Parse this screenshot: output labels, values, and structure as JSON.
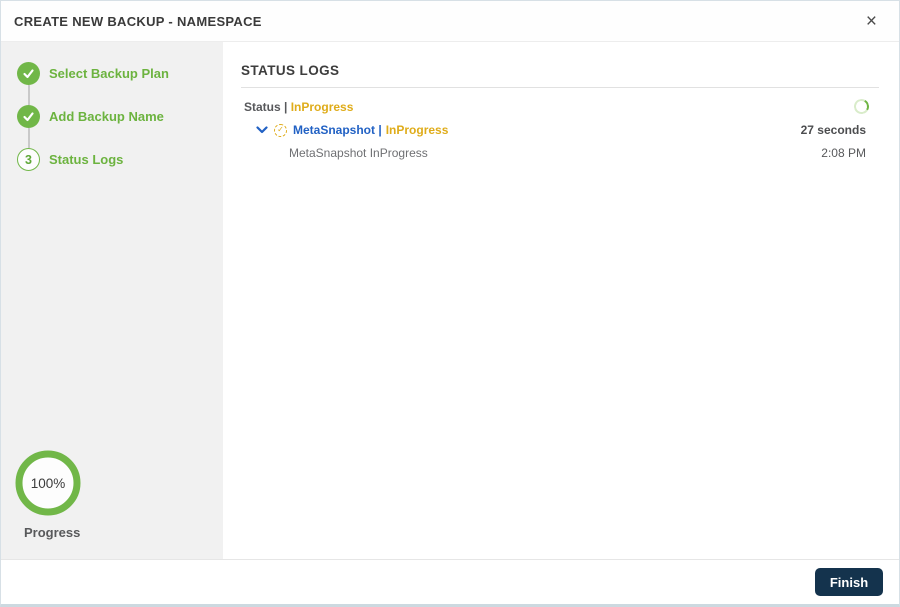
{
  "modal": {
    "title": "CREATE NEW BACKUP - NAMESPACE",
    "close_icon": "×"
  },
  "sidebar": {
    "steps": [
      {
        "label": "Select Backup Plan",
        "state": "complete"
      },
      {
        "label": "Add Backup Name",
        "state": "complete"
      },
      {
        "label": "Status Logs",
        "state": "current",
        "number": "3"
      }
    ],
    "progress": {
      "percent": "100%",
      "label": "Progress"
    }
  },
  "main": {
    "heading": "STATUS LOGS",
    "status_line": {
      "prefix": "Status |",
      "value": "InProgress"
    },
    "log_entry": {
      "name": "MetaSnapshot |",
      "status": "InProgress",
      "duration": "27 seconds",
      "detail": "MetaSnapshot InProgress",
      "time": "2:08 PM"
    }
  },
  "footer": {
    "finish_label": "Finish"
  },
  "colors": {
    "green": "#6cb33f",
    "gold": "#dfac1a",
    "blue": "#2161c4",
    "navy_button": "#14334d",
    "sidebar_bg": "#f1f1f1"
  }
}
